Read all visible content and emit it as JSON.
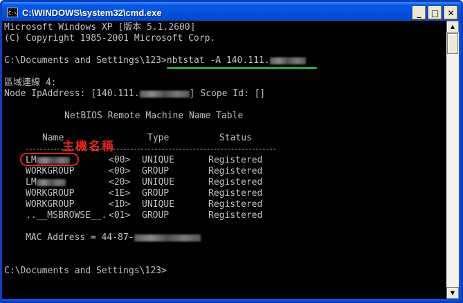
{
  "window": {
    "title": "C:\\WINDOWS\\system32\\cmd.exe",
    "icon_text": "C:\\",
    "minimize_glyph": "_",
    "maximize_glyph": "□",
    "close_glyph": "✕"
  },
  "console": {
    "header1": "Microsoft Windows XP [版本 5.1.2600]",
    "header2": "(C) Copyright 1985-2001 Microsoft Corp.",
    "prompt1": "C:\\Documents and Settings\\123>",
    "command": "nbtstat -A 140.111.",
    "adapter": "區域連線 4:",
    "node_label": "Node IpAddress: [140.111.",
    "node_scope": "] Scope Id: []",
    "table_title": "NetBIOS Remote Machine Name Table",
    "col_name": "Name",
    "col_type": "Type",
    "col_status": "Status",
    "rows": [
      {
        "name": "LM",
        "code": "<00>",
        "type": "UNIQUE",
        "status": "Registered"
      },
      {
        "name": "WORKGROUP",
        "code": "<00>",
        "type": "GROUP",
        "status": "Registered"
      },
      {
        "name": "LM",
        "code": "<20>",
        "type": "UNIQUE",
        "status": "Registered"
      },
      {
        "name": "WORKGROUP",
        "code": "<1E>",
        "type": "GROUP",
        "status": "Registered"
      },
      {
        "name": "WORKGROUP",
        "code": "<1D>",
        "type": "UNIQUE",
        "status": "Registered"
      },
      {
        "name": "..__MSBROWSE__.",
        "code": "<01>",
        "type": "GROUP",
        "status": "Registered"
      }
    ],
    "mac_label": "MAC Address = 44-87-",
    "prompt2": "C:\\Documents and Settings\\123>"
  },
  "annotation": {
    "host_name_label": "主機名稱"
  },
  "scrollbar": {
    "up_glyph": "▲",
    "down_glyph": "▼"
  },
  "colors": {
    "annotation_red": "#e3231c",
    "annotation_green": "#1faa3f",
    "console_bg": "#000000",
    "console_text": "#c0c0c0"
  }
}
